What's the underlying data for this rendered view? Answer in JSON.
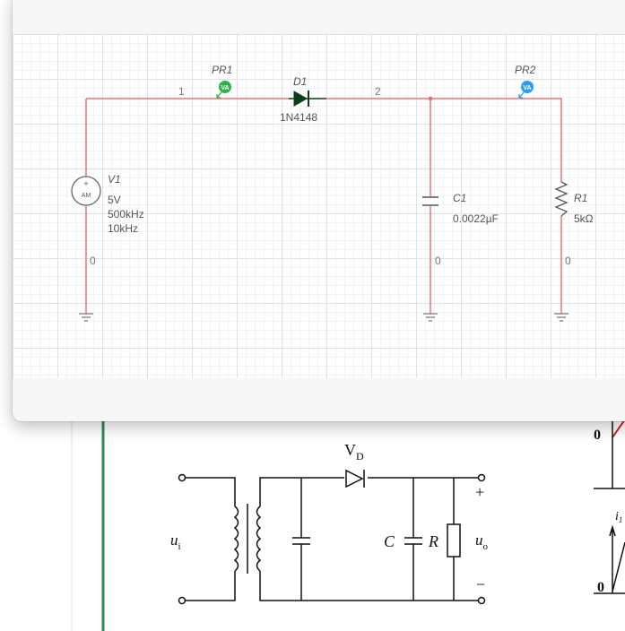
{
  "window": {
    "title": ""
  },
  "schematic": {
    "nets": {
      "n1": "1",
      "n2": "2",
      "gnd_v1": "0",
      "gnd_c1": "0",
      "gnd_r1": "0"
    },
    "probes": {
      "pr1": {
        "label": "PR1",
        "badge": "VA",
        "color": "#2db34a"
      },
      "pr2": {
        "label": "PR2",
        "badge": "VA",
        "color": "#2a9df4"
      }
    },
    "diode": {
      "ref": "D1",
      "part": "1N4148"
    },
    "source": {
      "ref": "V1",
      "symbol_plus": "+",
      "symbol_text": "AM",
      "amplitude": "5V",
      "carrier": "500kHz",
      "modulation": "10kHz"
    },
    "capacitor": {
      "ref": "C1",
      "value": "0.0022µF"
    },
    "resistor": {
      "ref": "R1",
      "value": "5kΩ"
    },
    "wire_color": "#e07a7a"
  },
  "textbook": {
    "diode_label": "V",
    "diode_sub": "D",
    "input_label": "u",
    "input_sub": "i",
    "cap_label": "C",
    "res_label": "R",
    "output_label": "u",
    "output_sub": "o",
    "plus": "+",
    "minus": "−",
    "right_zero_top": "0",
    "right_zero_bottom": "0",
    "right_current_label": "i",
    "right_current_sub": "1"
  }
}
